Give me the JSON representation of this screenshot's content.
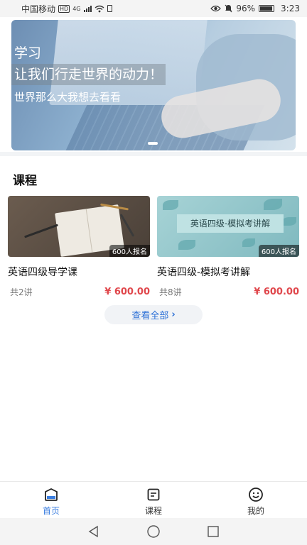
{
  "status_bar": {
    "carrier": "中国移动",
    "hd_badge": "HD",
    "network": "4G",
    "battery": "96%",
    "time": "3:23"
  },
  "banner": {
    "line1": "学习",
    "line2": "让我们行走世界的动力！",
    "line3": "世界那么大我想去看看"
  },
  "section": {
    "title": "课程"
  },
  "courses": [
    {
      "title": "英语四级导学课",
      "enroll": "600人报名",
      "lessons": "共2讲",
      "price": "¥ 600.00"
    },
    {
      "title": "英语四级-模拟考讲解",
      "thumb_text": "英语四级-模拟考讲解",
      "enroll": "600人报名",
      "lessons": "共8讲",
      "price": "¥ 600.00"
    }
  ],
  "view_all": {
    "label": "查看全部",
    "chevron": "›"
  },
  "tabbar": {
    "items": [
      {
        "label": "首页",
        "icon": "home-icon",
        "active": true
      },
      {
        "label": "课程",
        "icon": "course-icon",
        "active": false
      },
      {
        "label": "我的",
        "icon": "smiley-icon",
        "active": false
      }
    ]
  },
  "colors": {
    "accent": "#3a7ee0",
    "price": "#e0474c"
  }
}
